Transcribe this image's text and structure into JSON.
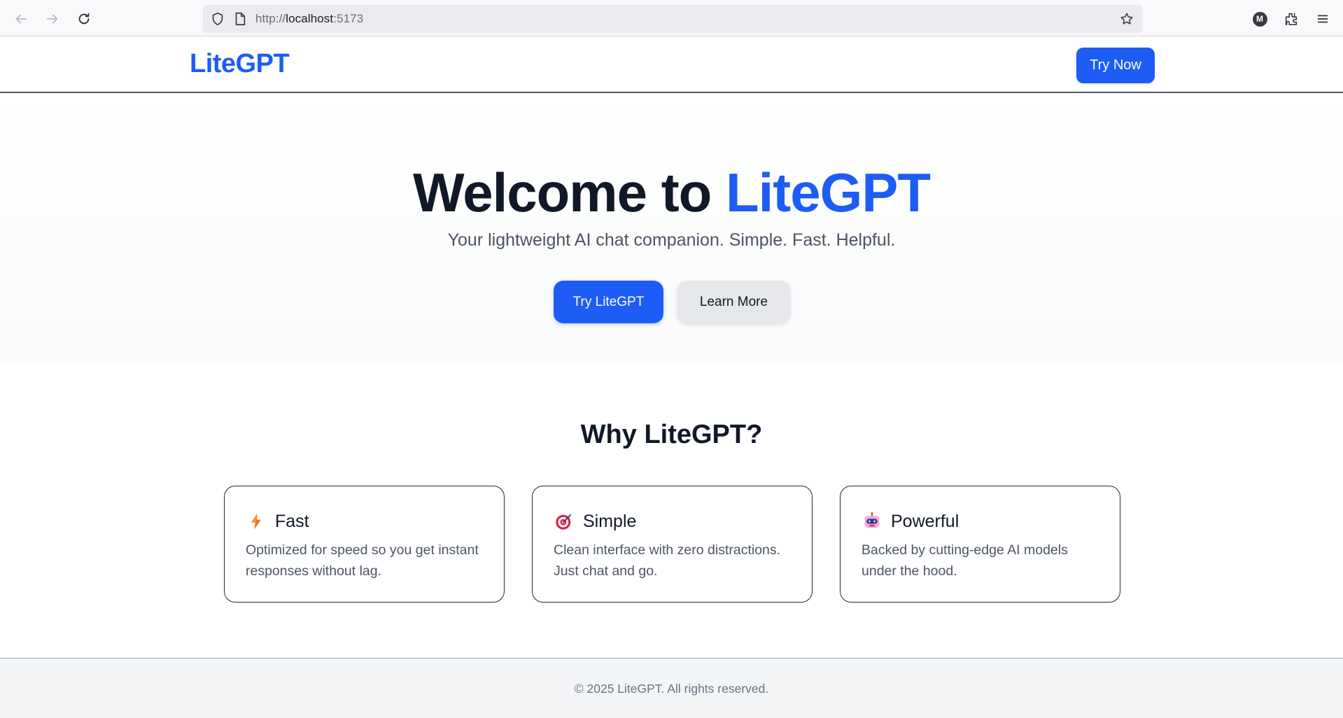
{
  "browser": {
    "url_prefix": "http://",
    "url_host": "localhost",
    "url_port": ":5173",
    "profile_initial": "M"
  },
  "header": {
    "logo": "LiteGPT",
    "cta_label": "Try Now"
  },
  "hero": {
    "title_prefix": "Welcome to ",
    "title_accent": "LiteGPT",
    "subtitle": "Your lightweight AI chat companion. Simple. Fast. Helpful.",
    "primary_label": "Try LiteGPT",
    "secondary_label": "Learn More"
  },
  "features": {
    "title": "Why LiteGPT?",
    "cards": [
      {
        "icon": "lightning-icon",
        "title": "Fast",
        "text": "Optimized for speed so you get instant responses without lag."
      },
      {
        "icon": "target-icon",
        "title": "Simple",
        "text": "Clean interface with zero distractions. Just chat and go."
      },
      {
        "icon": "robot-icon",
        "title": "Powerful",
        "text": "Backed by cutting-edge AI models under the hood."
      }
    ]
  },
  "footer": {
    "text": "© 2025 LiteGPT. All rights reserved."
  },
  "colors": {
    "brand": "#1d5cf5",
    "heading": "#111827",
    "body_text": "#4b5563"
  }
}
